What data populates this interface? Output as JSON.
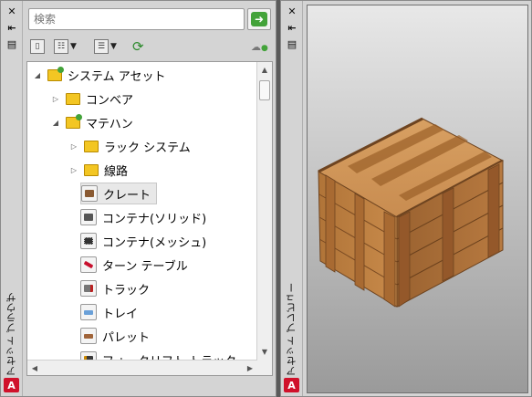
{
  "browser": {
    "title": "アセット ブラウザ",
    "search_placeholder": "検索",
    "tree": [
      {
        "label": "システム アセット",
        "type": "folder",
        "expander": "◢"
      },
      {
        "label": "コンベア",
        "type": "folder",
        "expander": "▷"
      },
      {
        "label": "マテハン",
        "type": "folder",
        "expander": "◢"
      },
      {
        "label": "ラック システム",
        "type": "folder",
        "expander": "▷"
      },
      {
        "label": "線路",
        "type": "folder",
        "expander": "▷"
      },
      {
        "label": "クレート",
        "type": "asset"
      },
      {
        "label": "コンテナ(ソリッド)",
        "type": "asset"
      },
      {
        "label": "コンテナ(メッシュ)",
        "type": "asset"
      },
      {
        "label": "ターン テーブル",
        "type": "asset"
      },
      {
        "label": "トラック",
        "type": "asset"
      },
      {
        "label": "トレイ",
        "type": "asset"
      },
      {
        "label": "パレット",
        "type": "asset"
      },
      {
        "label": "フォークリフト トラック",
        "type": "asset"
      }
    ]
  },
  "preview": {
    "title": "アセット プレビュー"
  },
  "icons": {
    "close": "close-icon",
    "pin": "pin-icon",
    "menu": "properties-menu-icon",
    "logo": "autodesk-logo-icon"
  },
  "colors": {
    "folder": "#f3c623",
    "go_green": "#43a33a",
    "logo_red": "#d0112b"
  }
}
